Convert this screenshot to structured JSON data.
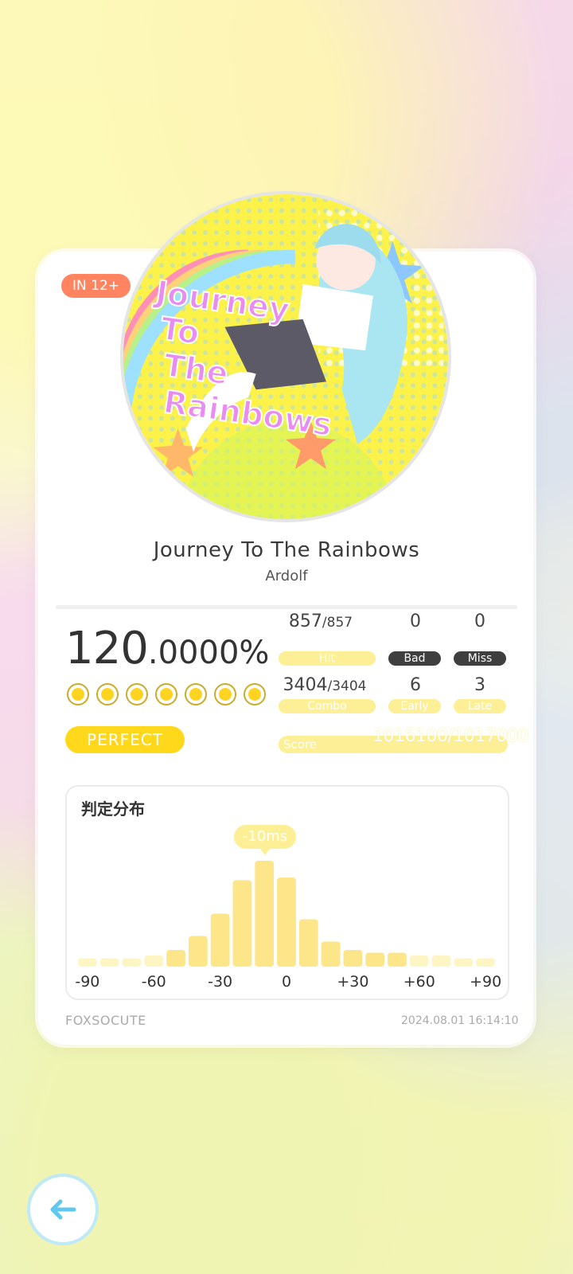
{
  "chart": {
    "level": "IN 12+",
    "title": "Journey To The Rainbows",
    "artist": "Ardolf"
  },
  "jacket_text": "Journey To The Rainbows",
  "result": {
    "accuracy_int": "120",
    "accuracy_dec": ".0000%",
    "rank": "PERFECT",
    "coins_filled": 7
  },
  "stats": {
    "hit": "857",
    "hit_total": "/857",
    "hit_label": "Hit",
    "bad": "0",
    "bad_label": "Bad",
    "miss": "0",
    "miss_label": "Miss",
    "combo": "3404",
    "combo_total": "/3404",
    "combo_label": "Combo",
    "early": "6",
    "early_label": "Early",
    "late": "3",
    "late_label": "Late",
    "score_label": "Score",
    "score": "1016100/1017000"
  },
  "distribution": {
    "title": "判定分布",
    "offset": "-10ms",
    "x_labels": [
      "-90",
      "-60",
      "-30",
      "0",
      "+30",
      "+60",
      "+90"
    ]
  },
  "chart_data": {
    "type": "bar",
    "title": "判定分布",
    "categories": [
      "-90",
      "-80",
      "-70",
      "-60",
      "-50",
      "-40",
      "-30",
      "-20",
      "-10",
      "0",
      "+10",
      "+20",
      "+30",
      "+40",
      "+50",
      "+60",
      "+70",
      "+80",
      "+90"
    ],
    "values": [
      3,
      3,
      3,
      4,
      6,
      11,
      19,
      31,
      38,
      32,
      17,
      9,
      6,
      5,
      5,
      4,
      4,
      3,
      3
    ],
    "ylim": [
      0,
      40
    ],
    "colors": {
      "bar": "#fde68a",
      "bar_light": "#fef5c4"
    }
  },
  "footer": {
    "player": "FOXSOCUTE",
    "datetime": "2024.08.01 16:14:10"
  },
  "colors": {
    "level_badge": "#ff845f",
    "rank": "#ffd81c",
    "label_yellow": "#fdef95",
    "label_dark": "#3f3f3f",
    "back_border": "#bfe9f6",
    "back_arrow": "#5ec8ee"
  },
  "icons": {
    "back": "arrow-left-icon",
    "coin": "coin-icon"
  }
}
